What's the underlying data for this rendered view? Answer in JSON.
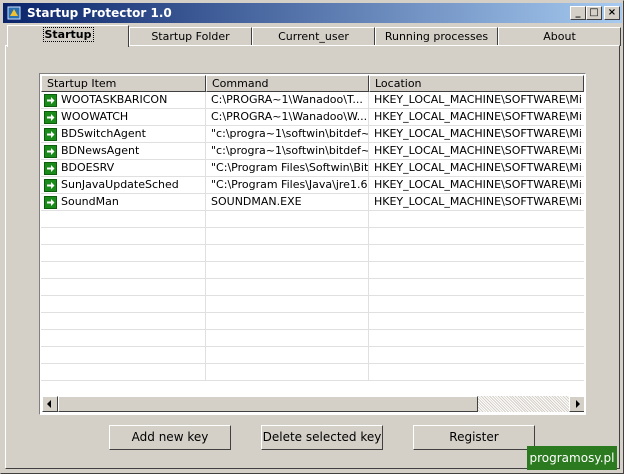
{
  "window": {
    "title": "Startup Protector 1.0",
    "controls": {
      "minimize": "_",
      "maximize": "□",
      "close": "×"
    }
  },
  "tabs": [
    {
      "label": "Startup",
      "active": true
    },
    {
      "label": "Startup Folder",
      "active": false
    },
    {
      "label": "Current_user",
      "active": false
    },
    {
      "label": "Running processes",
      "active": false
    },
    {
      "label": "About",
      "active": false
    }
  ],
  "list": {
    "columns": [
      "Startup Item",
      "Command",
      "Location"
    ],
    "rows": [
      {
        "item": "WOOTASKBARICON",
        "command": "C:\\PROGRA~1\\Wanadoo\\T...",
        "location": "HKEY_LOCAL_MACHINE\\SOFTWARE\\Mi",
        "icon": "run-arrow-icon"
      },
      {
        "item": "WOOWATCH",
        "command": "C:\\PROGRA~1\\Wanadoo\\W...",
        "location": "HKEY_LOCAL_MACHINE\\SOFTWARE\\Mi",
        "icon": "run-arrow-icon"
      },
      {
        "item": "BDSwitchAgent",
        "command": "\"c:\\progra~1\\softwin\\bitdef~...",
        "location": "HKEY_LOCAL_MACHINE\\SOFTWARE\\Mi",
        "icon": "run-arrow-icon"
      },
      {
        "item": "BDNewsAgent",
        "command": "\"c:\\progra~1\\softwin\\bitdef~...",
        "location": "HKEY_LOCAL_MACHINE\\SOFTWARE\\Mi",
        "icon": "run-arrow-icon"
      },
      {
        "item": "BDOESRV",
        "command": "\"C:\\Program Files\\Softwin\\Bit...",
        "location": "HKEY_LOCAL_MACHINE\\SOFTWARE\\Mi",
        "icon": "run-arrow-icon"
      },
      {
        "item": "SunJavaUpdateSched",
        "command": "\"C:\\Program Files\\Java\\jre1.6...",
        "location": "HKEY_LOCAL_MACHINE\\SOFTWARE\\Mi",
        "icon": "run-arrow-icon"
      },
      {
        "item": "SoundMan",
        "command": "SOUNDMAN.EXE",
        "location": "HKEY_LOCAL_MACHINE\\SOFTWARE\\Mi",
        "icon": "run-arrow-icon"
      }
    ]
  },
  "buttons": {
    "add": "Add new key",
    "delete": "Delete selected key",
    "register": "Register"
  },
  "watermark": "programosy.pl",
  "colors": {
    "titlebar_start": "#0a246a",
    "titlebar_end": "#a6caf0",
    "face": "#d4d0c8",
    "run_icon": "#1a8a1a",
    "watermark_bg": "#2c7a1f"
  }
}
